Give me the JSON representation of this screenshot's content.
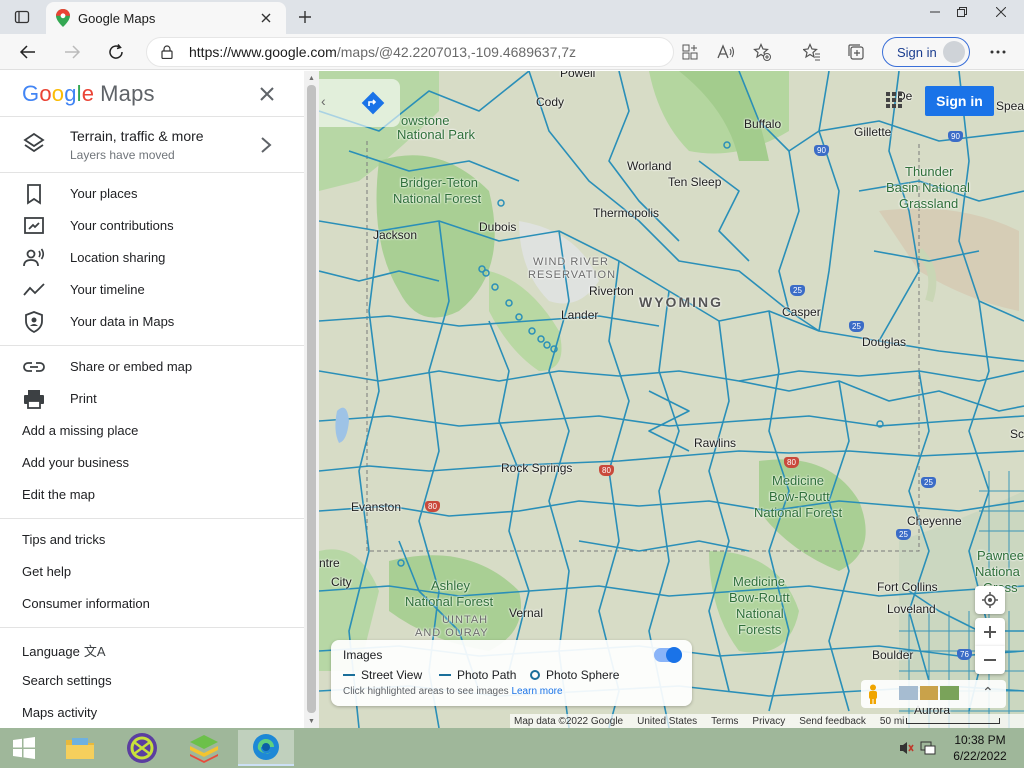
{
  "browser": {
    "tab_title": "Google Maps",
    "url_prefix": "https://www.google.com",
    "url_rest": "/maps/@42.2207013,-109.4689637,7z",
    "signin_label": "Sign in"
  },
  "panel": {
    "logo_google": "Google",
    "logo_maps": "Maps",
    "layers_title": "Terrain, traffic & more",
    "layers_subtitle": "Layers have moved",
    "group1": [
      {
        "label": "Your places",
        "icon": "bookmark-icon"
      },
      {
        "label": "Your contributions",
        "icon": "contributions-icon"
      },
      {
        "label": "Location sharing",
        "icon": "location-sharing-icon"
      },
      {
        "label": "Your timeline",
        "icon": "timeline-icon"
      },
      {
        "label": "Your data in Maps",
        "icon": "shield-icon"
      }
    ],
    "group2": [
      {
        "label": "Share or embed map",
        "icon": "link-icon"
      },
      {
        "label": "Print",
        "icon": "printer-icon"
      },
      {
        "label": "Add a missing place"
      },
      {
        "label": "Add your business"
      },
      {
        "label": "Edit the map"
      }
    ],
    "group3": [
      {
        "label": "Tips and tricks"
      },
      {
        "label": "Get help"
      },
      {
        "label": "Consumer information"
      }
    ],
    "group4": [
      {
        "label": "Language"
      },
      {
        "label": "Search settings"
      },
      {
        "label": "Maps activity"
      }
    ],
    "language_icon_glyph": "文A"
  },
  "map": {
    "signin": "Sign in",
    "places": {
      "powell": "Powell",
      "cody": "Cody",
      "yellowstone": "owstone",
      "national_park": "National Park",
      "buffalo": "Buffalo",
      "gillette": "Gillette",
      "thunder": "Thunder",
      "basin": "Basin National",
      "grassland": "Grassland",
      "worland": "Worland",
      "ten_sleep": "Ten Sleep",
      "bridger": "Bridger-Teton",
      "bridger2": "National Forest",
      "thermopolis": "Thermopolis",
      "jackson": "Jackson",
      "dubois": "Dubois",
      "wind1": "WIND RIVER",
      "wind2": "RESERVATION",
      "riverton": "Riverton",
      "wyoming": "WYOMING",
      "lander": "Lander",
      "casper": "Casper",
      "douglas": "Douglas",
      "rawlins": "Rawlins",
      "rock_springs": "Rock Springs",
      "medicine1": "Medicine",
      "medicine2": "Bow-Routt",
      "medicine3": "National Forest",
      "evanston": "Evanston",
      "cheyenne": "Cheyenne",
      "pawnee1": "Pawnee",
      "pawnee2": "Nationa",
      "pawnee3": "Grass",
      "city": "City",
      "ashley1": "Ashley",
      "ashley2": "National Forest",
      "vernal": "Vernal",
      "uintah1": "UINTAH",
      "uintah2": "AND OURAY",
      "mb1": "Medicine",
      "mb2": "Bow-Routt",
      "mb3": "National",
      "mb4": "Forests",
      "fort_collins": "Fort Collins",
      "loveland": "Loveland",
      "boulder": "Boulder",
      "aurora": "Aurora",
      "dea": "De",
      "spea": "Spea",
      "sc": "Sc",
      "ntv": "ntre"
    },
    "shields": {
      "i90a": "90",
      "i90b": "90",
      "i25a": "25",
      "i25b": "25",
      "i25c": "25",
      "i25d": "25",
      "i80a": "80",
      "i80b": "80",
      "i80c": "80",
      "i76": "76"
    },
    "images_card": {
      "title": "Images",
      "street_view": "Street View",
      "photo_path": "Photo Path",
      "photo_sphere": "Photo Sphere",
      "hint": "Click highlighted areas to see images",
      "learn_more": "Learn more"
    },
    "footer": {
      "map_data": "Map data ©2022 Google",
      "country": "United States",
      "terms": "Terms",
      "privacy": "Privacy",
      "feedback": "Send feedback",
      "scale": "50 mi"
    }
  },
  "taskbar": {
    "time": "10:38 PM",
    "date": "6/22/2022"
  },
  "colors": {
    "accent": "#1a73e8",
    "road": "#2a8fb8",
    "map_bg": "#d7dcc6",
    "forest": "#a9cf94"
  }
}
